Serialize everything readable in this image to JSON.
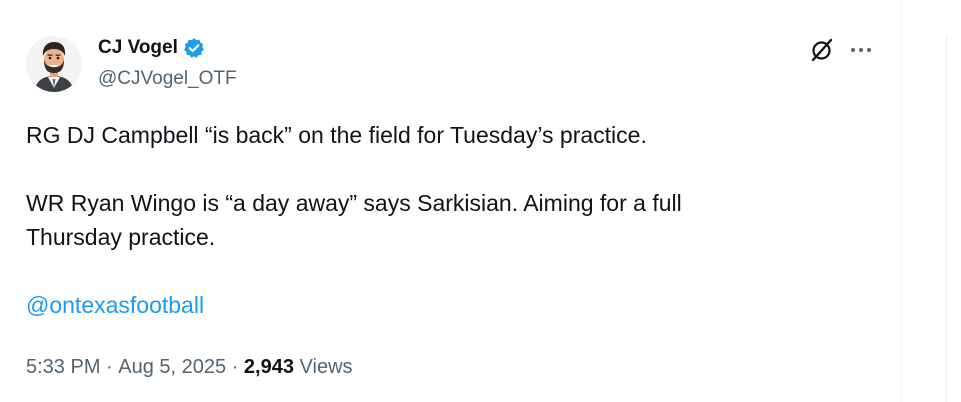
{
  "author": {
    "display_name": "CJ Vogel",
    "handle": "@CJVogel_OTF",
    "verified": true,
    "avatar_icon": "cartoon-man-avatar"
  },
  "actions": {
    "grok_icon": "grok-slash-icon",
    "more_icon": "more-dots-icon"
  },
  "tweet": {
    "line1": "RG DJ Campbell “is back” on the field for Tuesday’s practice.",
    "line2": "WR Ryan Wingo is “a day away” says Sarkisian. Aiming for a full",
    "line3": "Thursday practice.",
    "mention": "@ontexasfootball"
  },
  "meta": {
    "time": "5:33 PM",
    "separator": " · ",
    "date": "Aug 5, 2025",
    "views_count": "2,943",
    "views_label": " Views"
  },
  "colors": {
    "link": "#1d9bf0",
    "secondary_text": "#536471",
    "primary_text": "#0f1419",
    "verified_badge": "#1d9bf0"
  }
}
